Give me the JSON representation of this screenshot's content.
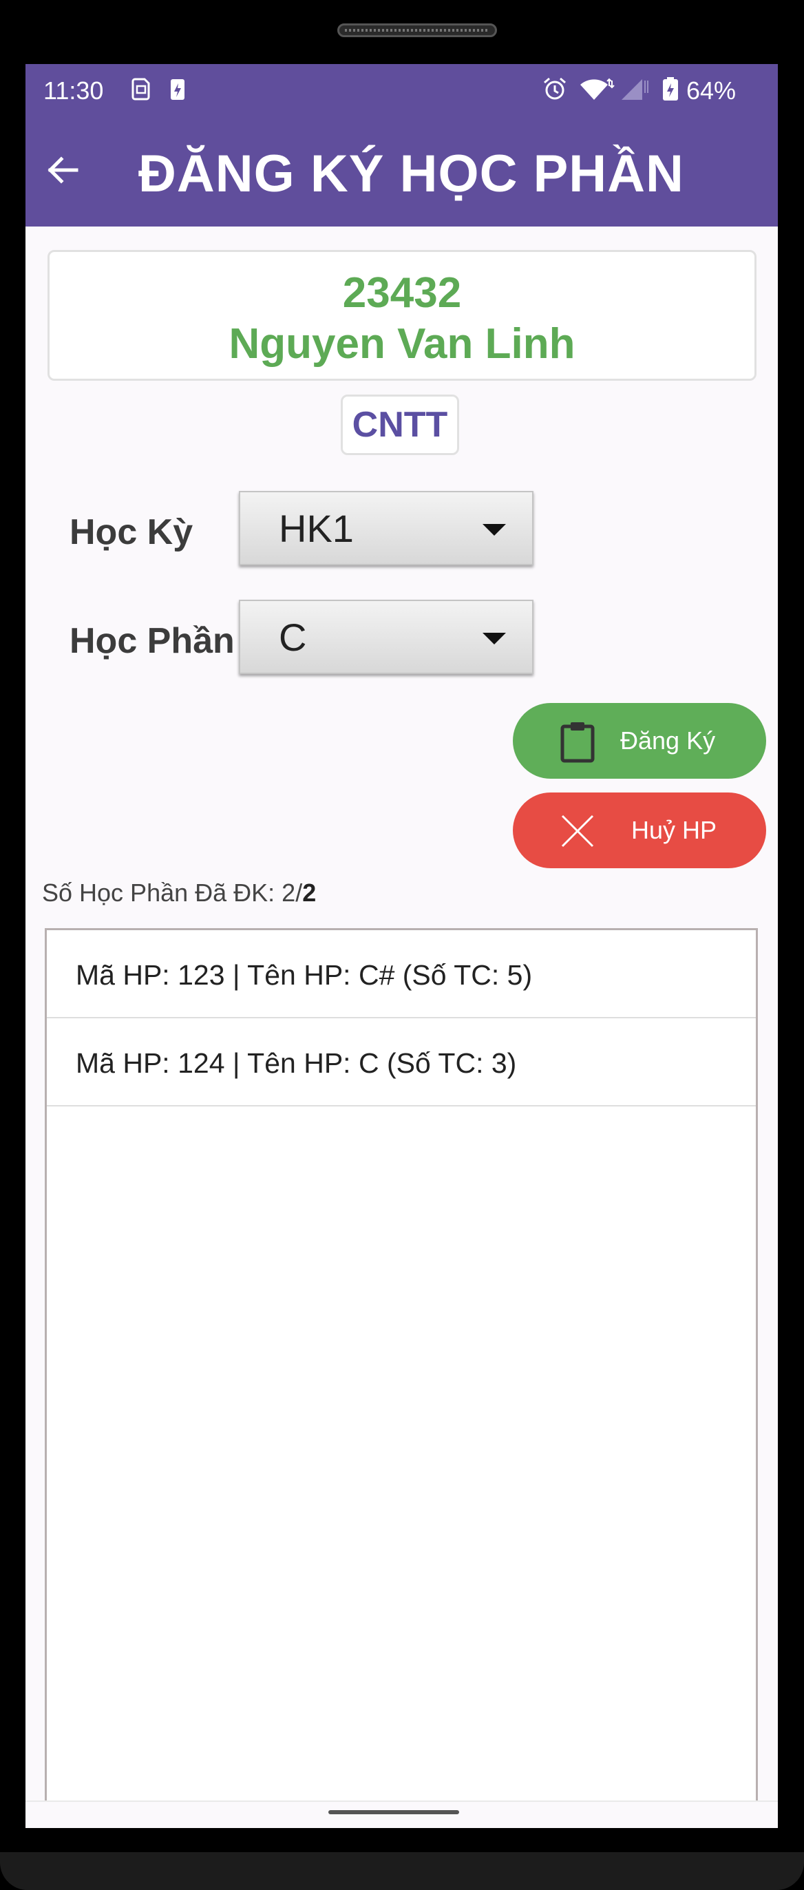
{
  "status_bar": {
    "time": "11:30",
    "battery": "64%",
    "icons": [
      "sim-card-icon",
      "battery-saver-icon",
      "alarm-icon",
      "wifi-icon",
      "signal-icon",
      "battery-icon"
    ]
  },
  "app_bar": {
    "title": "ĐĂNG KÝ HỌC PHẦN",
    "back_icon": "arrow-left-icon"
  },
  "student": {
    "id": "23432",
    "name": "Nguyen Van Linh",
    "faculty": "CNTT"
  },
  "form": {
    "semester_label": "Học Kỳ",
    "semester_value": "HK1",
    "course_label": "Học Phần",
    "course_value": "C"
  },
  "actions": {
    "register_label": "Đăng Ký",
    "register_icon": "clipboard-icon",
    "cancel_label": "Huỷ HP",
    "cancel_icon": "close-icon"
  },
  "summary": {
    "prefix": "Số Học Phần Đã ĐK: 2/",
    "max": "2"
  },
  "courses": [
    {
      "text": "Mã HP: 123 | Tên HP: C# (Số TC: 5)"
    },
    {
      "text": "Mã HP: 124 | Tên HP: C (Số TC: 3)"
    }
  ],
  "colors": {
    "primary": "#604e9c",
    "student_text": "#5daa55",
    "register_button": "#5fae58",
    "cancel_button": "#e74c44"
  }
}
